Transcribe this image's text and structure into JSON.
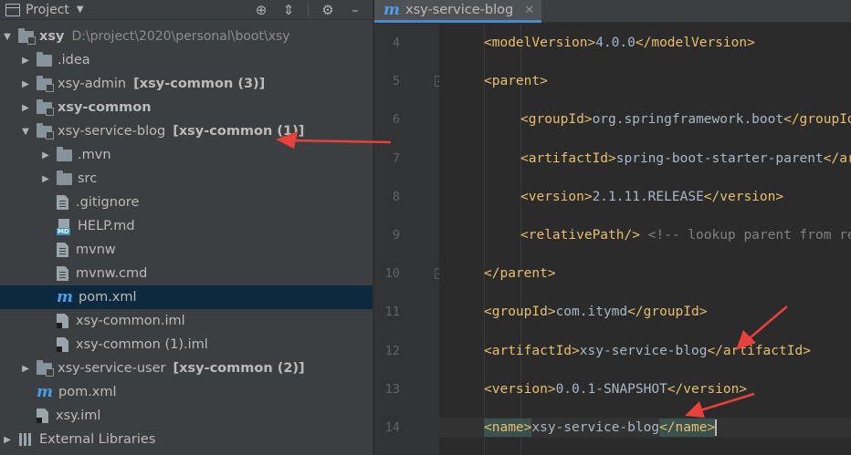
{
  "project_panel": {
    "title": "Project",
    "tools": [
      "crosshair-icon",
      "collapse-all-icon",
      "gear-icon",
      "hide-icon"
    ],
    "tree": [
      {
        "label": "xsy",
        "path": "D:\\project\\2020\\personal\\boot\\xsy",
        "badge": "",
        "bold": true,
        "icon": "module-icon",
        "expander": "expanded",
        "level": 0
      },
      {
        "label": ".idea",
        "path": "",
        "badge": "",
        "bold": false,
        "icon": "folder-icon",
        "expander": "collapsed",
        "level": 1
      },
      {
        "label": "xsy-admin",
        "path": "",
        "badge": "[xsy-common (3)]",
        "bold": false,
        "icon": "module-icon",
        "expander": "collapsed",
        "level": 1
      },
      {
        "label": "xsy-common",
        "path": "",
        "badge": "",
        "bold": true,
        "icon": "module-icon",
        "expander": "collapsed",
        "level": 1
      },
      {
        "label": "xsy-service-blog",
        "path": "",
        "badge": "[xsy-common (1)]",
        "bold": false,
        "icon": "module-icon",
        "expander": "expanded",
        "level": 1
      },
      {
        "label": ".mvn",
        "path": "",
        "badge": "",
        "bold": false,
        "icon": "folder-icon",
        "expander": "collapsed",
        "level": 2
      },
      {
        "label": "src",
        "path": "",
        "badge": "",
        "bold": false,
        "icon": "folder-icon",
        "expander": "collapsed",
        "level": 2
      },
      {
        "label": ".gitignore",
        "path": "",
        "badge": "",
        "bold": false,
        "icon": "file-icon",
        "expander": "none",
        "level": 2
      },
      {
        "label": "HELP.md",
        "path": "",
        "badge": "",
        "bold": false,
        "icon": "md-icon",
        "expander": "none",
        "level": 2
      },
      {
        "label": "mvnw",
        "path": "",
        "badge": "",
        "bold": false,
        "icon": "file-icon",
        "expander": "none",
        "level": 2
      },
      {
        "label": "mvnw.cmd",
        "path": "",
        "badge": "",
        "bold": false,
        "icon": "file-icon",
        "expander": "none",
        "level": 2
      },
      {
        "label": "pom.xml",
        "path": "",
        "badge": "",
        "bold": false,
        "icon": "maven-icon",
        "expander": "none",
        "level": 2,
        "selected": true
      },
      {
        "label": "xsy-common.iml",
        "path": "",
        "badge": "",
        "bold": false,
        "icon": "iml-icon",
        "expander": "none",
        "level": 2
      },
      {
        "label": "xsy-common (1).iml",
        "path": "",
        "badge": "",
        "bold": false,
        "icon": "iml-icon",
        "expander": "none",
        "level": 2
      },
      {
        "label": "xsy-service-user",
        "path": "",
        "badge": "[xsy-common (2)]",
        "bold": false,
        "icon": "module-icon",
        "expander": "collapsed",
        "level": 1
      },
      {
        "label": "pom.xml",
        "path": "",
        "badge": "",
        "bold": false,
        "icon": "maven-icon",
        "expander": "none",
        "level": 1
      },
      {
        "label": "xsy.iml",
        "path": "",
        "badge": "",
        "bold": false,
        "icon": "iml-icon",
        "expander": "none",
        "level": 1
      },
      {
        "label": "External Libraries",
        "path": "",
        "badge": "",
        "bold": false,
        "icon": "lib-icon",
        "expander": "collapsed",
        "level": 0
      }
    ]
  },
  "editor": {
    "tab": {
      "label": "xsy-service-blog",
      "icon": "maven-icon",
      "close": "✕"
    },
    "lines": [
      {
        "n": "4",
        "indent": 1,
        "parts": [
          [
            "tag",
            "<modelVersion>"
          ],
          [
            "txt",
            "4.0.0"
          ],
          [
            "tag",
            "</modelVersion>"
          ]
        ]
      },
      {
        "n": "5",
        "indent": 1,
        "parts": [
          [
            "tag",
            "<parent>"
          ]
        ],
        "fold": true
      },
      {
        "n": "6",
        "indent": 2,
        "parts": [
          [
            "tag",
            "<groupId>"
          ],
          [
            "txt",
            "org.springframework.boot"
          ],
          [
            "tag",
            "</groupId>"
          ]
        ]
      },
      {
        "n": "7",
        "indent": 2,
        "parts": [
          [
            "tag",
            "<artifactId>"
          ],
          [
            "txt",
            "spring-boot-starter-parent"
          ],
          [
            "tag",
            "</artifactId>"
          ]
        ]
      },
      {
        "n": "8",
        "indent": 2,
        "parts": [
          [
            "tag",
            "<version>"
          ],
          [
            "txt",
            "2.1.11.RELEASE"
          ],
          [
            "tag",
            "</version>"
          ]
        ]
      },
      {
        "n": "9",
        "indent": 2,
        "parts": [
          [
            "tag",
            "<relativePath/>"
          ],
          [
            "cmt",
            " <!-- lookup parent from repository -->"
          ]
        ]
      },
      {
        "n": "10",
        "indent": 1,
        "parts": [
          [
            "tag",
            "</parent>"
          ]
        ],
        "fold": true
      },
      {
        "n": "11",
        "indent": 1,
        "parts": [
          [
            "tag",
            "<groupId>"
          ],
          [
            "txt",
            "com.itymd"
          ],
          [
            "tag",
            "</groupId>"
          ]
        ]
      },
      {
        "n": "12",
        "indent": 1,
        "parts": [
          [
            "tag",
            "<artifactId>"
          ],
          [
            "txt",
            "xsy-service-blog"
          ],
          [
            "tag",
            "</artifactId>"
          ]
        ]
      },
      {
        "n": "13",
        "indent": 1,
        "parts": [
          [
            "tag",
            "<version>"
          ],
          [
            "txt",
            "0.0.1-SNAPSHOT"
          ],
          [
            "tag",
            "</version>"
          ]
        ]
      },
      {
        "n": "14",
        "indent": 1,
        "parts": [
          [
            "taghl",
            "<name>"
          ],
          [
            "txt",
            "xsy-service-blog"
          ],
          [
            "taghl",
            "</name>"
          ],
          [
            "caret",
            ""
          ]
        ],
        "current": true
      }
    ]
  },
  "colors": {
    "annotation_arrow": "#e8413b",
    "tag": "#e8bf6a",
    "text": "#a9b7c6",
    "comment": "#808080",
    "selection": "#0d293e"
  }
}
